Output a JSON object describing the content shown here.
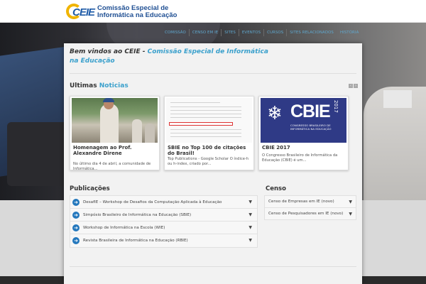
{
  "site": {
    "logo_letters": "CEIE",
    "logo_line1": "Comissão Especial de",
    "logo_line2": "Informática na Educação"
  },
  "nav": {
    "items": [
      "COMISSÃO",
      "CENSO EM IE",
      "SITES",
      "EVENTOS",
      "CURSOS",
      "SITES RELACIONADOS",
      "HISTÓRIA"
    ]
  },
  "welcome": {
    "prefix": "Bem vindos ao CEIE - ",
    "accent": "Comissão Especial de Informática na Educação"
  },
  "news": {
    "title_prefix": "Ultimas ",
    "title_accent": "Noticias",
    "prev_icon": "arrow-left-icon",
    "next_icon": "arrow-right-icon",
    "cards": [
      {
        "caption": "Homenagem ao Prof. Alexandre Direne",
        "desc": "No último dia 4 de abril, a comunidade de Informática..."
      },
      {
        "caption": "SBIE no Top 100 de citações do Brasil!",
        "desc": "Top Publications - Google Scholar O índice-h ou h-index, criado por..."
      },
      {
        "caption": "CBIE 2017",
        "desc": " O Congresso Brasileiro de Informática da Educação (CBIE) é um..."
      }
    ],
    "cbie_image": {
      "big": "CBIE",
      "year": "2017",
      "sub": "CONGRESSO BRASILEIRO DE INFORMÁTICA NA EDUCAÇÃO"
    }
  },
  "publicacoes": {
    "title": "Publicações",
    "items": [
      "DesafIE – Workshop de Desafios da Computação Aplicada à Educação",
      "Simpósio Brasileiro de Informática na Educação (SBIE)",
      "Workshop de Informática na Escola (WIE)",
      "Revista Brasileira de Informática na Educação (RBIE)"
    ]
  },
  "censo": {
    "title": "Censo",
    "items": [
      "Censo de Empresas em IE (novo)",
      "Censo de Pesquisadores em IE (novo)"
    ]
  },
  "colors": {
    "accent": "#3aa0cc",
    "link_icon": "#2478bd",
    "logo_yellow": "#f0b400",
    "logo_blue": "#1f5ca8"
  },
  "icons": {
    "pub_item": "arrow-circle-right-icon",
    "expand": "chevron-down-icon"
  }
}
